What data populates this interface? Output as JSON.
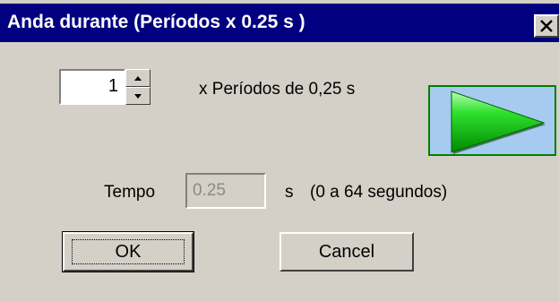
{
  "window": {
    "title": "Anda durante (Períodos x 0.25 s )",
    "close_icon": "close-icon"
  },
  "periods": {
    "value": "1",
    "label": "x Períodos de 0,25 s",
    "up_icon": "spin-up-icon",
    "down_icon": "spin-down-icon"
  },
  "play_button": {
    "icon": "play-triangle-icon",
    "background": "#a6caf0",
    "triangle_color": "#00c000"
  },
  "tempo": {
    "label": "Tempo",
    "value": "0.25",
    "unit": "s",
    "range": "(0 a 64 segundos)"
  },
  "buttons": {
    "ok": "OK",
    "cancel": "Cancel"
  },
  "colors": {
    "titlebar": "#000080",
    "face": "#d4d0c8"
  }
}
